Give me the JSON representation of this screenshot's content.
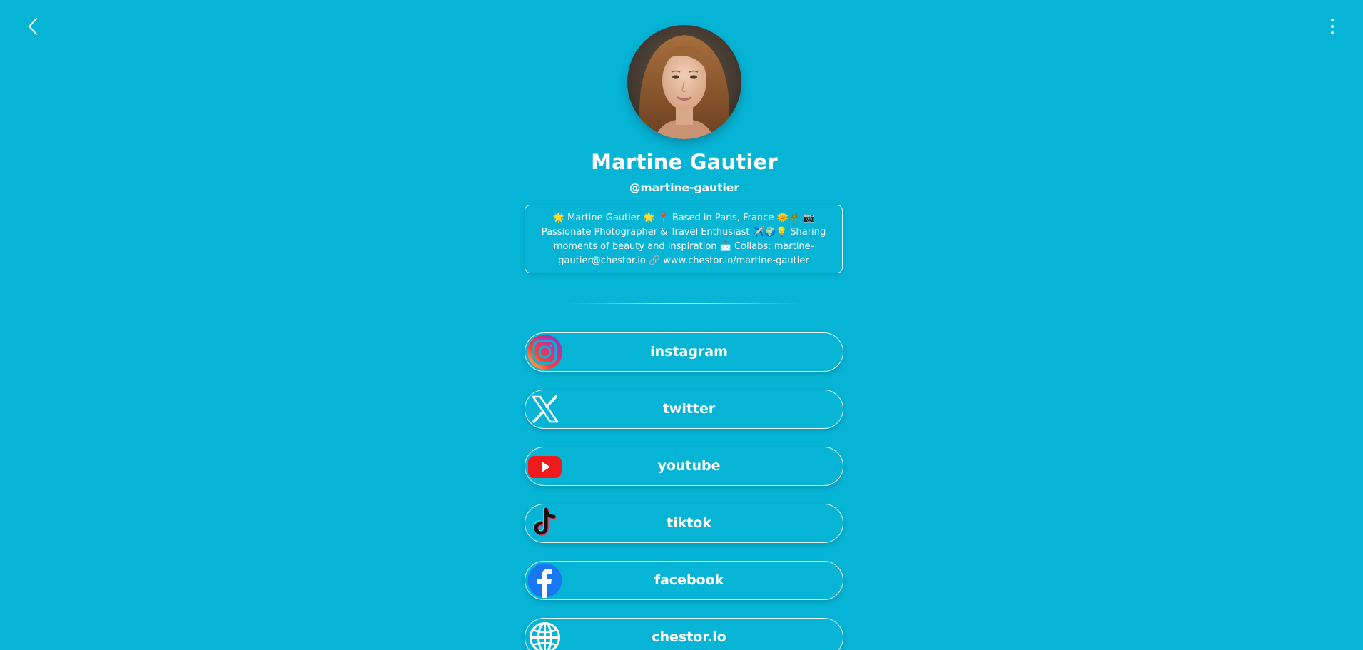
{
  "nav": {
    "back_icon": "chevron-left-icon",
    "menu_icon": "more-vertical-icon"
  },
  "profile": {
    "name": "Martine Gautier",
    "handle": "@martine-gautier",
    "bio": "🌟 Martine Gautier 🌟 📍 Based in Paris, France 🌞🌴 📷 Passionate Photographer & Travel Enthusiast ✈️🌍💡 Sharing moments of beauty and inspiration 📩 Collabs: martine-gautier@chestor.io 🔗 www.chestor.io/martine-gautier"
  },
  "links": [
    {
      "label": "instagram",
      "icon": "instagram-icon"
    },
    {
      "label": "twitter",
      "icon": "x-twitter-icon"
    },
    {
      "label": "youtube",
      "icon": "youtube-icon"
    },
    {
      "label": "tiktok",
      "icon": "tiktok-icon"
    },
    {
      "label": "facebook",
      "icon": "facebook-icon"
    },
    {
      "label": "chestor.io",
      "icon": "globe-icon"
    }
  ],
  "colors": {
    "background": "#06b4d6",
    "text": "#ffffff",
    "youtube_red": "#f0191b",
    "facebook_blue": "#1877f2"
  }
}
